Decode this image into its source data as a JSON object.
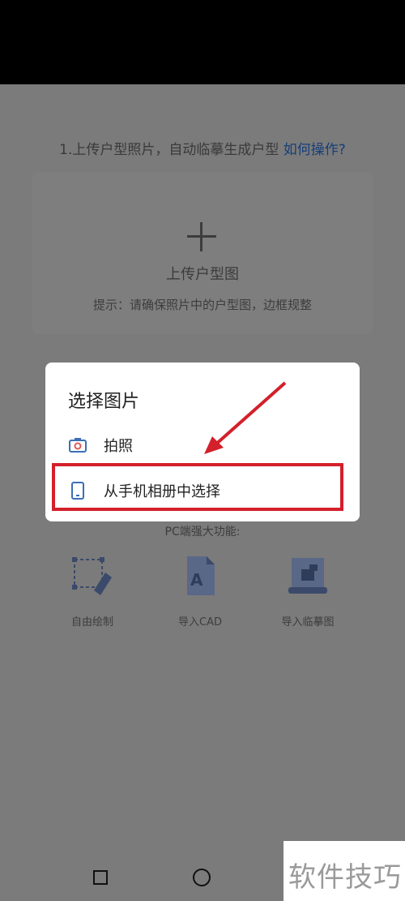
{
  "instruction": {
    "text": "1.上传户型照片，自动临摹生成户型",
    "link": "如何操作?"
  },
  "upload": {
    "label": "上传户型图",
    "tip": "提示：请确保照片中的户型图，边框规整"
  },
  "pc_features": {
    "title": "PC端强大功能:",
    "items": [
      {
        "label": "自由绘制",
        "icon": "pen-draw-icon"
      },
      {
        "label": "导入CAD",
        "icon": "cad-file-icon"
      },
      {
        "label": "导入临摹图",
        "icon": "trace-image-icon"
      }
    ]
  },
  "dialog": {
    "title": "选择图片",
    "options": [
      {
        "label": "拍照",
        "icon": "camera-icon"
      },
      {
        "label": "从手机相册中选择",
        "icon": "phone-icon"
      }
    ]
  },
  "annotation": {
    "highlight_color": "#d3202b"
  },
  "navbar": {
    "buttons": [
      "recent-apps-icon",
      "home-icon"
    ]
  },
  "watermark": {
    "text": "软件技巧"
  }
}
